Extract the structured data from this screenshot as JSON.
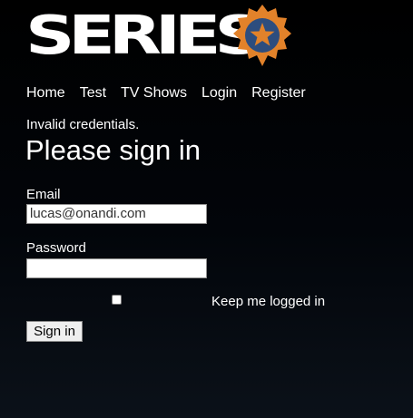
{
  "logo": {
    "text": "SERIES",
    "badge_color": "#e2822a",
    "star_circle_color": "#2d4d7e"
  },
  "nav": {
    "items": [
      "Home",
      "Test",
      "TV Shows",
      "Login",
      "Register"
    ]
  },
  "alert": "Invalid credentials.",
  "title": "Please sign in",
  "form": {
    "email_label": "Email",
    "email_value": "lucas@onandi.com",
    "password_label": "Password",
    "password_value": "",
    "remember_label": "Keep me logged in",
    "remember_checked": false,
    "submit_label": "Sign in"
  }
}
